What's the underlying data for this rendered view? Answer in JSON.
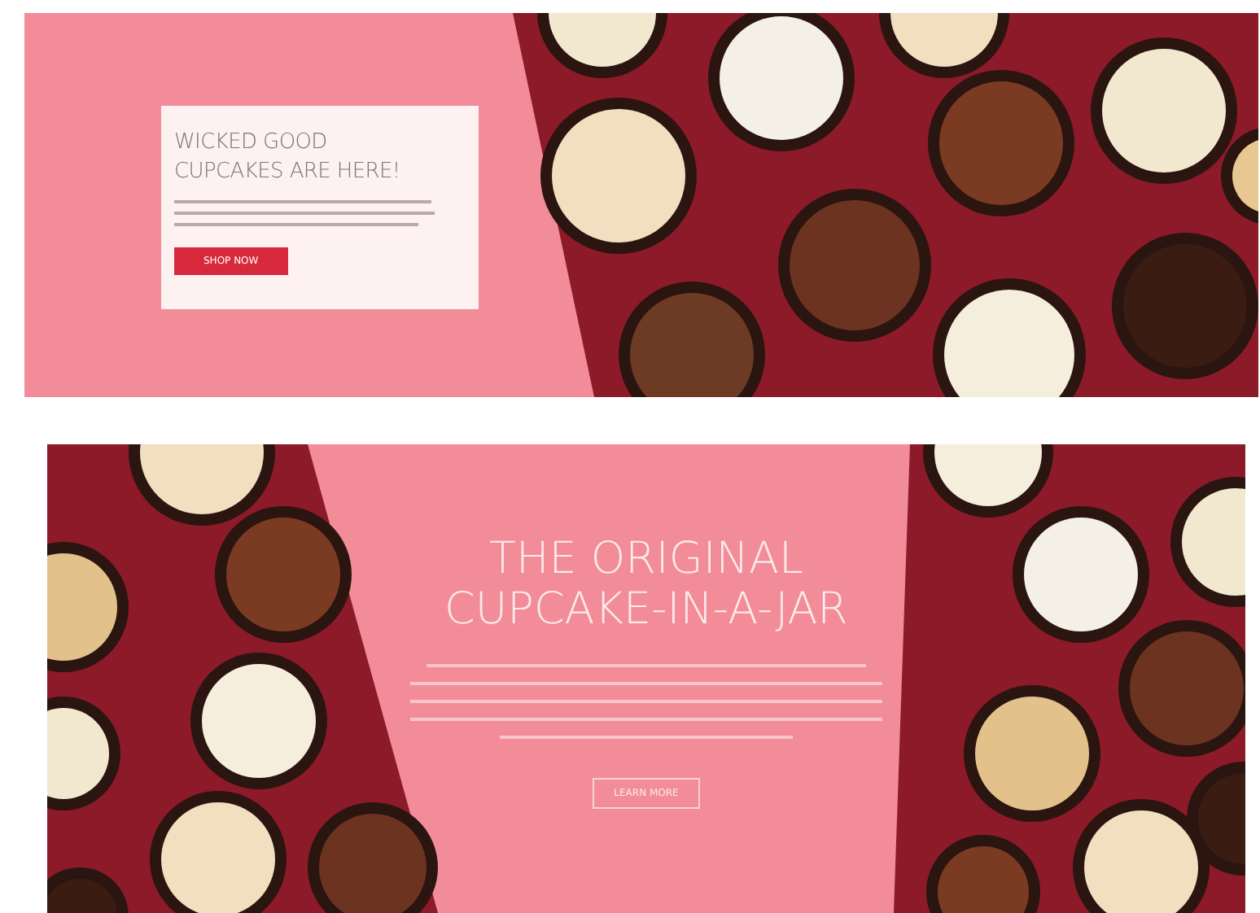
{
  "banners": [
    {
      "kind": "card",
      "heading": "WICKED GOOD CUPCAKES ARE HERE!",
      "button": "SHOP NOW"
    },
    {
      "kind": "overlay",
      "heading": "THE ORIGINAL CUPCAKE-IN-A-JAR",
      "button": "LEARN MORE"
    }
  ]
}
